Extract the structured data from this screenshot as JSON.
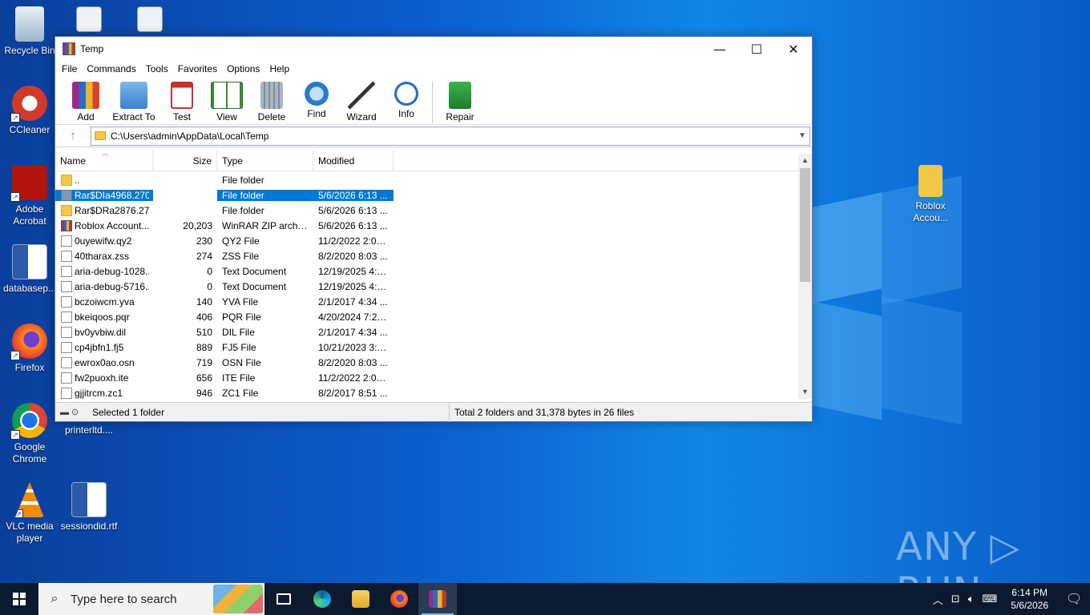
{
  "desktop": {
    "icons_left": [
      {
        "label": "Recycle Bin"
      },
      {
        "label": "CCleaner"
      },
      {
        "label": "Adobe Acrobat"
      },
      {
        "label": "databasep..."
      },
      {
        "label": "Firefox"
      },
      {
        "label": "Google Chrome"
      },
      {
        "label": "VLC media player"
      }
    ],
    "icons_col2": [
      {
        "label": "printerltd...."
      },
      {
        "label": "sessiondid.rtf"
      }
    ],
    "icon_right": {
      "label": "Roblox Accou..."
    },
    "watermark": "ANY ▷ RUN"
  },
  "window": {
    "title": "Temp",
    "controls": {
      "minimize": "—",
      "maximize": "☐",
      "close": "✕"
    },
    "menu": [
      "File",
      "Commands",
      "Tools",
      "Favorites",
      "Options",
      "Help"
    ],
    "toolbar": [
      {
        "label": "Add",
        "icon": "add-archive-icon",
        "color": "#d9432f"
      },
      {
        "label": "Extract To",
        "icon": "extract-folder-icon",
        "color": "#4a90d9"
      },
      {
        "label": "Test",
        "icon": "test-clipboard-icon",
        "color": "#c9302c"
      },
      {
        "label": "View",
        "icon": "view-book-icon",
        "color": "#3c8a3c"
      },
      {
        "label": "Delete",
        "icon": "delete-trash-icon",
        "color": "#8a9aa8"
      },
      {
        "label": "Find",
        "icon": "find-magnifier-icon",
        "color": "#2a7ac8"
      },
      {
        "label": "Wizard",
        "icon": "wizard-wand-icon",
        "color": "#5a5a5a"
      },
      {
        "label": "Info",
        "icon": "info-icon",
        "color": "#2a6cc4"
      },
      {
        "label": "Repair",
        "icon": "repair-kit-icon",
        "color": "#2f9a3e"
      }
    ],
    "address": "C:\\Users\\admin\\AppData\\Local\\Temp",
    "columns": {
      "name": "Name",
      "size": "Size",
      "type": "Type",
      "modified": "Modified"
    },
    "rows": [
      {
        "name": "..",
        "size": "",
        "type": "File folder",
        "modified": "",
        "kind": "folder"
      },
      {
        "name": "Rar$DIa4968.270...",
        "size": "",
        "type": "File folder",
        "modified": "5/6/2026 6:13 ...",
        "kind": "folder",
        "selected": true
      },
      {
        "name": "Rar$DRa2876.27...",
        "size": "",
        "type": "File folder",
        "modified": "5/6/2026 6:13 ...",
        "kind": "folder"
      },
      {
        "name": "Roblox Account...",
        "size": "20,203",
        "type": "WinRAR ZIP archive",
        "modified": "5/6/2026 6:13 ...",
        "kind": "rar"
      },
      {
        "name": "0uyewifw.qy2",
        "size": "230",
        "type": "QY2 File",
        "modified": "11/2/2022 2:05 ...",
        "kind": "doc"
      },
      {
        "name": "40tharax.zss",
        "size": "274",
        "type": "ZSS File",
        "modified": "8/2/2020 8:03 ...",
        "kind": "doc"
      },
      {
        "name": "aria-debug-1028...",
        "size": "0",
        "type": "Text Document",
        "modified": "12/19/2025 4:2...",
        "kind": "doc"
      },
      {
        "name": "aria-debug-5716...",
        "size": "0",
        "type": "Text Document",
        "modified": "12/19/2025 4:3...",
        "kind": "doc"
      },
      {
        "name": "bczoiwcm.yva",
        "size": "140",
        "type": "YVA File",
        "modified": "2/1/2017 4:34 ...",
        "kind": "doc"
      },
      {
        "name": "bkeiqoos.pqr",
        "size": "406",
        "type": "PQR File",
        "modified": "4/20/2024 7:29 ...",
        "kind": "doc"
      },
      {
        "name": "bv0yvbiw.dil",
        "size": "510",
        "type": "DIL File",
        "modified": "2/1/2017 4:34 ...",
        "kind": "doc"
      },
      {
        "name": "cp4jbfn1.fj5",
        "size": "889",
        "type": "FJ5 File",
        "modified": "10/21/2023 3:1...",
        "kind": "doc"
      },
      {
        "name": "ewrox0ao.osn",
        "size": "719",
        "type": "OSN File",
        "modified": "8/2/2020 8:03 ...",
        "kind": "doc"
      },
      {
        "name": "fw2puoxh.ite",
        "size": "656",
        "type": "ITE File",
        "modified": "11/2/2022 2:05 ...",
        "kind": "doc"
      },
      {
        "name": "gjjitrcm.zc1",
        "size": "946",
        "type": "ZC1 File",
        "modified": "8/2/2017 8:51 ...",
        "kind": "doc"
      }
    ],
    "status": {
      "left": "Selected 1 folder",
      "right": "Total 2 folders and 31,378 bytes in 26 files"
    }
  },
  "taskbar": {
    "search_placeholder": "Type here to search",
    "time": "6:14 PM",
    "date": "5/6/2026"
  }
}
